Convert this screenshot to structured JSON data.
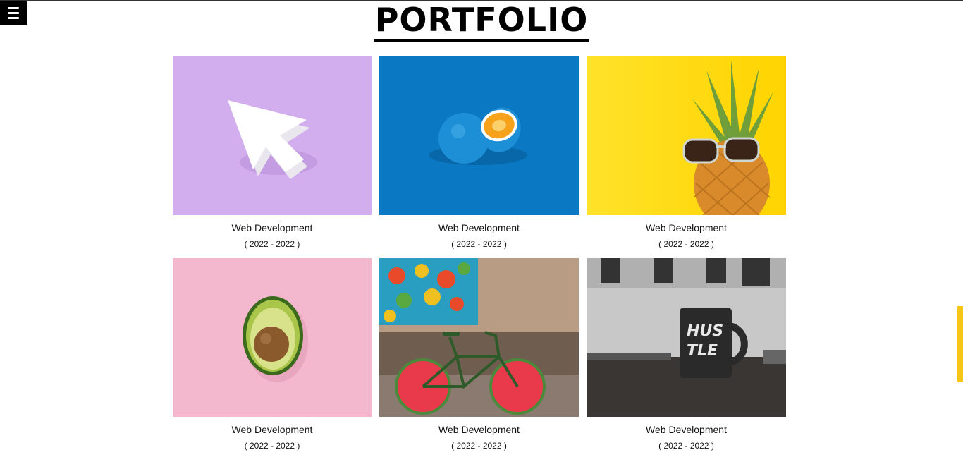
{
  "page": {
    "title": "PORTFOLIO"
  },
  "menu": {
    "icon": "hamburger-menu-icon"
  },
  "colors": {
    "accent_tab": "#f5c518"
  },
  "projects": [
    {
      "title": "Web Development",
      "date": "( 2022 - 2022 )",
      "image": "cursor-arrow-on-lavender"
    },
    {
      "title": "Web Development",
      "date": "( 2022 - 2022 )",
      "image": "blue-painted-orange-on-blue"
    },
    {
      "title": "Web Development",
      "date": "( 2022 - 2022 )",
      "image": "pineapple-with-sunglasses-on-yellow"
    },
    {
      "title": "Web Development",
      "date": "( 2022 - 2022 )",
      "image": "avocado-half-on-pink"
    },
    {
      "title": "Web Development",
      "date": "( 2022 - 2022 )",
      "image": "watermelon-wheel-bicycle-by-wall"
    },
    {
      "title": "Web Development",
      "date": "( 2022 - 2022 )",
      "image": "hustle-mug-on-desk"
    }
  ]
}
